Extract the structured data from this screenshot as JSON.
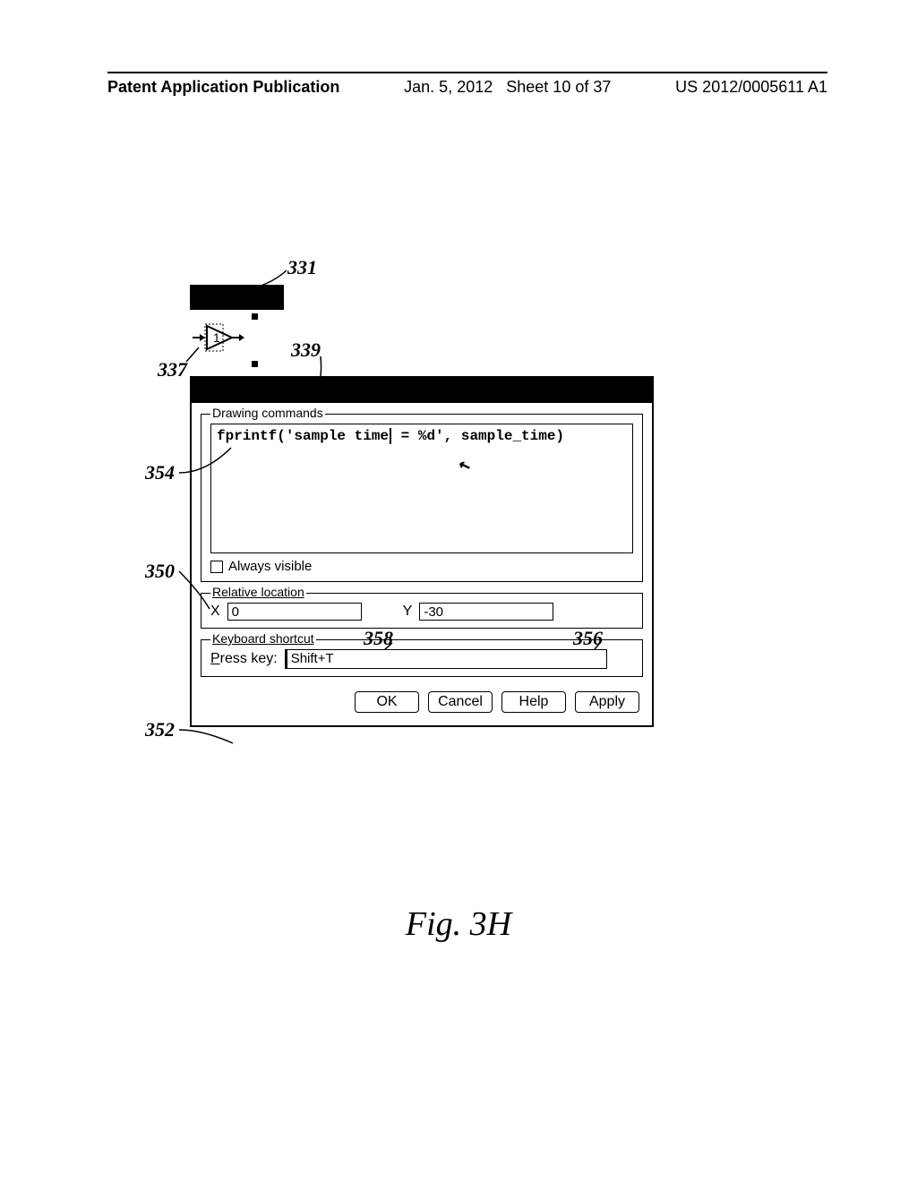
{
  "header": {
    "left": "Patent Application Publication",
    "date": "Jan. 5, 2012",
    "sheet": "Sheet 10 of 37",
    "pubno": "US 2012/0005611 A1"
  },
  "refs": {
    "r331": "331",
    "r337": "337",
    "r339": "339",
    "r354": "354",
    "r350": "350",
    "r352": "352",
    "r356": "356",
    "r358": "358"
  },
  "block": {
    "label": "1"
  },
  "dialog": {
    "drawing": {
      "legend": "Drawing commands",
      "code_a": "fprintf('sample time",
      "code_b": " = %d', sample_time)",
      "always_visible_label": "Always visible"
    },
    "relloc": {
      "legend": "Relative location",
      "x_label": "X",
      "x_value": "0",
      "y_label": "Y",
      "y_value": "-30"
    },
    "kbd": {
      "legend": "Keyboard shortcut",
      "press_label_pre": "P",
      "press_label_post": "ress key:",
      "value": "Shift+T"
    },
    "buttons": {
      "ok": "OK",
      "cancel": "Cancel",
      "help": "Help",
      "apply": "Apply"
    }
  },
  "figure_caption": "Fig. 3H"
}
